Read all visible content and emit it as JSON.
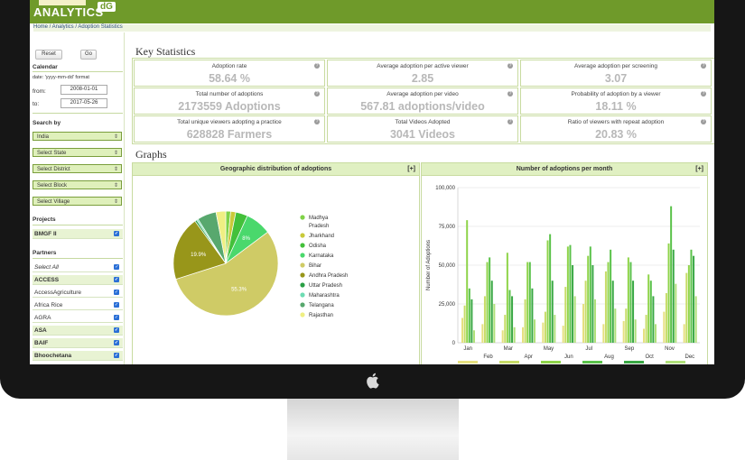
{
  "app": {
    "logo_text": "ANALYTICS",
    "logo_badge": "dG"
  },
  "breadcrumb": "Home / Analytics / Adoption Statistics",
  "sidebar": {
    "reset_label": "Reset",
    "go_label": "Go",
    "calendar_heading": "Calendar",
    "date_format_note": "date: 'yyyy-mm-dd' format",
    "from_label": "from:",
    "from_value": "2008-01-01",
    "to_label": "to:",
    "to_value": "2017-05-26",
    "search_heading": "Search by",
    "selects": [
      "India",
      "Select State",
      "Select District",
      "Select Block",
      "Select Village"
    ],
    "projects_heading": "Projects",
    "projects": [
      "BMGF II"
    ],
    "partners_heading": "Partners",
    "partners": [
      {
        "label": "Select All",
        "style": "italic"
      },
      {
        "label": "ACCESS",
        "style": "bold"
      },
      {
        "label": "AccessAgriculture",
        "style": "normal"
      },
      {
        "label": "Africa Rice",
        "style": "normal"
      },
      {
        "label": "AGRA",
        "style": "normal"
      },
      {
        "label": "ASA",
        "style": "bold"
      },
      {
        "label": "BAIF",
        "style": "bold"
      },
      {
        "label": "Bhoochetana",
        "style": "bold"
      }
    ]
  },
  "key_stats": {
    "title": "Key Statistics",
    "cells": [
      {
        "label": "Adoption rate",
        "value": "58.64 %"
      },
      {
        "label": "Average adoption per active viewer",
        "value": "2.85"
      },
      {
        "label": "Average adoption per screening",
        "value": "3.07"
      },
      {
        "label": "Total number of adoptions",
        "value": "2173559 Adoptions"
      },
      {
        "label": "Average adoption per video",
        "value": "567.81 adoptions/video"
      },
      {
        "label": "Probability of adoption by a viewer",
        "value": "18.11 %"
      },
      {
        "label": "Total unique viewers adopting a practice",
        "value": "628828 Farmers"
      },
      {
        "label": "Total Videos Adopted",
        "value": "3041 Videos"
      },
      {
        "label": "Ratio of viewers with repeat adoption",
        "value": "20.83 %"
      }
    ]
  },
  "graphs": {
    "title": "Graphs",
    "expand_label": "[+]",
    "geo_title": "Geographic distribution of adoptions",
    "month_title": "Number of adoptions per month"
  },
  "colors": {
    "header_green": "#6f9a2a",
    "panel_head": "#e0f0c2",
    "select_bg": "#dff0bb",
    "stat_value": "#b8b8b8"
  },
  "chart_data": [
    {
      "type": "pie",
      "title": "Geographic distribution of adoptions",
      "slices": [
        {
          "label": "Madhya Pradesh",
          "value": 1.5,
          "color": "#7fd247"
        },
        {
          "label": "Jharkhand",
          "value": 1.6,
          "color": "#c9ca3a"
        },
        {
          "label": "Odisha",
          "value": 3.7,
          "color": "#43c03a"
        },
        {
          "label": "Karnataka",
          "value": 8.0,
          "color": "#4ad86c"
        },
        {
          "label": "Bihar",
          "value": 55.3,
          "color": "#cfcb66"
        },
        {
          "label": "Andhra Pradesh",
          "value": 19.9,
          "color": "#98961a"
        },
        {
          "label": "Uttar Pradesh",
          "value": 0.6,
          "color": "#2a9f45"
        },
        {
          "label": "Maharashtra",
          "value": 0.5,
          "color": "#6edcb3"
        },
        {
          "label": "Telangana",
          "value": 5.9,
          "color": "#58a86e"
        },
        {
          "label": "Rajasthan",
          "value": 3.0,
          "color": "#efef83"
        }
      ],
      "data_labels": [
        {
          "label": "Karnataka",
          "text": "8%"
        },
        {
          "label": "Andhra Pradesh",
          "text": "19.9%"
        },
        {
          "label": "Bihar",
          "text": "55.3%"
        }
      ]
    },
    {
      "type": "bar",
      "title": "Number of adoptions per month",
      "ylabel": "Number of Adoptions",
      "ylim": [
        0,
        100000
      ],
      "yticks": [
        0,
        25000,
        50000,
        75000,
        100000
      ],
      "ytick_labels": [
        "0",
        "25,000",
        "50,000",
        "75,000",
        "100,000"
      ],
      "categories": [
        "Jan",
        "Feb",
        "Mar",
        "Apr",
        "May",
        "Jun",
        "Jul",
        "Aug",
        "Sep",
        "Oct",
        "Nov",
        "Dec"
      ],
      "xtick_labels_top": [
        "Jan",
        "Mar",
        "May",
        "Jul",
        "Sep",
        "Nov"
      ],
      "xtick_labels_bottom": [
        "Feb",
        "Apr",
        "Jun",
        "Aug",
        "Oct",
        "Dec"
      ],
      "series": [
        {
          "color": "#e6e080",
          "values": [
            16000,
            12000,
            8000,
            10000,
            13000,
            11000,
            25000,
            12000,
            14000,
            9000,
            20000,
            12000
          ]
        },
        {
          "color": "#c7dc68",
          "values": [
            24000,
            30000,
            18000,
            28000,
            20000,
            36000,
            40000,
            46000,
            22000,
            18000,
            32000,
            45000
          ]
        },
        {
          "color": "#8fd44a",
          "values": [
            79000,
            52000,
            58000,
            52000,
            66000,
            62000,
            56000,
            52000,
            55000,
            44000,
            64000,
            50000
          ]
        },
        {
          "color": "#5ac24a",
          "values": [
            35000,
            55000,
            34000,
            52000,
            70000,
            63000,
            62000,
            60000,
            52000,
            40000,
            88000,
            60000
          ]
        },
        {
          "color": "#3aa845",
          "values": [
            28000,
            40000,
            30000,
            35000,
            40000,
            50000,
            50000,
            40000,
            40000,
            30000,
            60000,
            56000
          ]
        },
        {
          "color": "#b0e07a",
          "values": [
            8000,
            25000,
            10000,
            15000,
            18000,
            30000,
            28000,
            22000,
            15000,
            12000,
            38000,
            30000
          ]
        }
      ]
    }
  ]
}
